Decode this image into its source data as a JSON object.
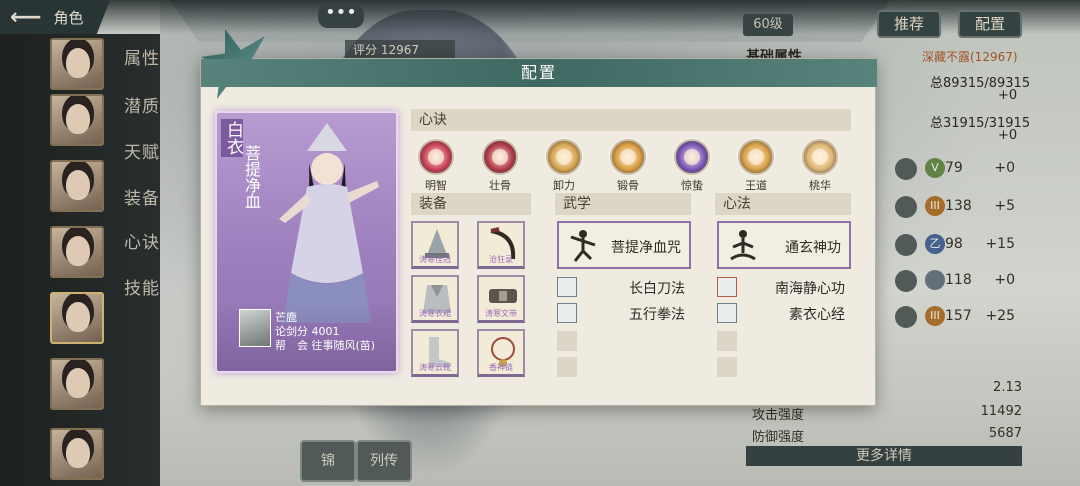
{
  "topbar": {
    "back_label": "角色",
    "chat": "•••"
  },
  "score": "评分 12967",
  "sidebar": {
    "tabs": [
      "属性",
      "潜质",
      "天赋",
      "装备",
      "心诀",
      "技能"
    ]
  },
  "right": {
    "level": "60级",
    "recommend_label": "推荐",
    "config_label": "配置",
    "base_title": "基础属性",
    "deep_text": "深藏不露(12967)",
    "total1": "总89315/89315",
    "plus1": "+0",
    "total2": "总31915/31915",
    "plus2": "+0",
    "attrs": [
      {
        "icon": "剑法",
        "tier": "V",
        "num": "79",
        "plus": "+0",
        "tier_color": "#6a8f4b"
      },
      {
        "icon": "奇门",
        "tier": "III",
        "num": "138",
        "plus": "+5",
        "tier_color": "#b4772d"
      },
      {
        "icon": "身法",
        "tier": "乙",
        "num": "98",
        "plus": "+15",
        "tier_color": "#4d6a9a"
      },
      {
        "icon": "福缘",
        "tier": "",
        "num": "118",
        "plus": "+0",
        "tier_color": "#6b7a86"
      },
      {
        "icon": "定力",
        "tier": "III",
        "num": "157",
        "plus": "+25",
        "tier_color": "#b4772d"
      }
    ],
    "stats": [
      {
        "label": "",
        "value": "2.13"
      },
      {
        "label": "攻击强度",
        "value": "11492"
      },
      {
        "label": "防御强度",
        "value": "5687"
      }
    ],
    "more_label": "更多详情"
  },
  "bottom": {
    "btn1": "锦",
    "btn2": "列传"
  },
  "dialog": {
    "title": "配置",
    "card": {
      "name_main": "白衣",
      "name_sub": "菩提净血",
      "owner": "芒鹿",
      "rank": "论剑分 4001",
      "guild": "帮　会 往事随风(苗)"
    },
    "xinjue_header": "心诀",
    "gems": [
      {
        "label": "明智",
        "color": "#c8415a"
      },
      {
        "label": "壮骨",
        "color": "#b23c4c"
      },
      {
        "label": "卸力",
        "color": "#d6a552"
      },
      {
        "label": "锻骨",
        "color": "#d99e44"
      },
      {
        "label": "惊蛰",
        "color": "#7b56b8"
      },
      {
        "label": "王道",
        "color": "#d8a24a"
      },
      {
        "label": "桃华",
        "color": "#e0b775"
      }
    ],
    "equip_header": "装备",
    "equips": [
      {
        "label": "涛寒佳冠",
        "kind": "hat"
      },
      {
        "label": "沧狂录",
        "kind": "weapon"
      },
      {
        "label": "涛寒衣裙",
        "kind": "armor"
      },
      {
        "label": "涛寒文带",
        "kind": "belt"
      },
      {
        "label": "涛寒云靴",
        "kind": "boots"
      },
      {
        "label": "香神链",
        "kind": "necklace"
      }
    ],
    "wuxue_header": "武学",
    "wuxue_main": "菩提净血咒",
    "wuxue_list": [
      "长白刀法",
      "五行拳法"
    ],
    "xinfa_header": "心法",
    "xinfa_main": "通玄神功",
    "xinfa_list": [
      "南海静心功",
      "素衣心经"
    ]
  }
}
